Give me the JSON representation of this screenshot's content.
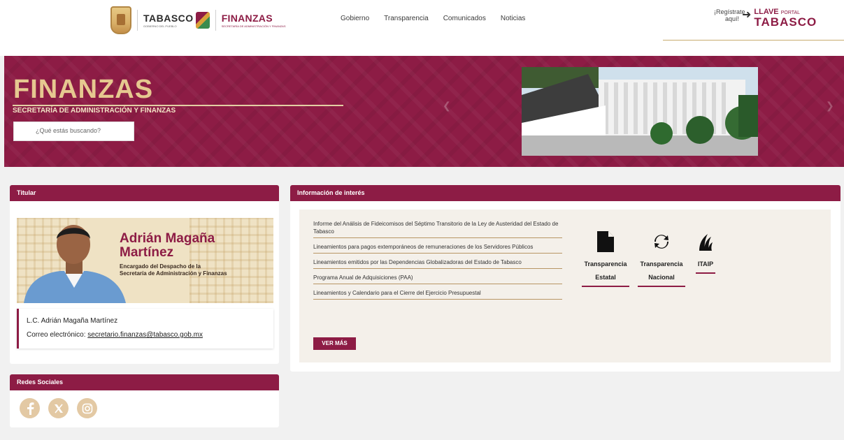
{
  "header": {
    "logo_tabasco": "TABASCO",
    "logo_tabasco_sub": "GOBIERNO DEL PUEBLO",
    "logo_finanzas": "FINANZAS",
    "logo_finanzas_sub": "SECRETARÍA DE ADMINISTRACIÓN Y FINANZAS",
    "nav": [
      "Gobierno",
      "Transparencia",
      "Comunicados",
      "Noticias"
    ],
    "llave": {
      "register": "¡Regístrate aquí!",
      "llave": "LLAVE",
      "portal": "PORTAL",
      "tabasco": "TABASCO"
    }
  },
  "banner": {
    "title": "FINANZAS",
    "subtitle": "SECRETARÍA DE ADMINISTRACIÓN Y FINANZAS",
    "search_placeholder": "¿Qué estás buscando?",
    "prev_icon": "chevron-left-icon",
    "next_icon": "chevron-right-icon"
  },
  "titular": {
    "heading": "Titular",
    "banner_name_line1": "Adrián Magaña",
    "banner_name_line2": "Martínez",
    "banner_role_line1": "Encargado del Despacho de la",
    "banner_role_line2": "Secretaría de Administración y Finanzas",
    "name": "L.C. Adrián Magaña Martínez",
    "email_label": "Correo electrónico:",
    "email": "secretario.finanzas@tabasco.gob.mx"
  },
  "info": {
    "heading": "Información de interés",
    "links": [
      "Informe del Análisis de Fideicomisos del Séptimo Transitorio de la Ley de Austeridad del Estado de Tabasco",
      "Lineamientos para pagos extemporáneos de remuneraciones de los Servidores Públicos",
      "Lineamientos emitidos por las Dependencias Globalizadoras del Estado de Tabasco",
      "Programa Anual de Adquisiciones (PAA)",
      "Lineamientos y Calendario para el Cierre del Ejercicio Presupuestal"
    ],
    "ver_mas": "VER MÁS",
    "tiles": [
      {
        "line1": "Transparencia",
        "line2": "Estatal",
        "icon": "document-icon"
      },
      {
        "line1": "Transparencia",
        "line2": "Nacional",
        "icon": "sync-icon"
      },
      {
        "line1": "ITAIP",
        "line2": "",
        "icon": "itaip-logo-icon"
      }
    ]
  },
  "redes": {
    "heading": "Redes Sociales",
    "icons": [
      "facebook-icon",
      "x-icon",
      "instagram-icon"
    ]
  },
  "colors": {
    "brand": "#8d1c45",
    "gold": "#e6c890",
    "panel_bg": "#f4f0ea"
  }
}
